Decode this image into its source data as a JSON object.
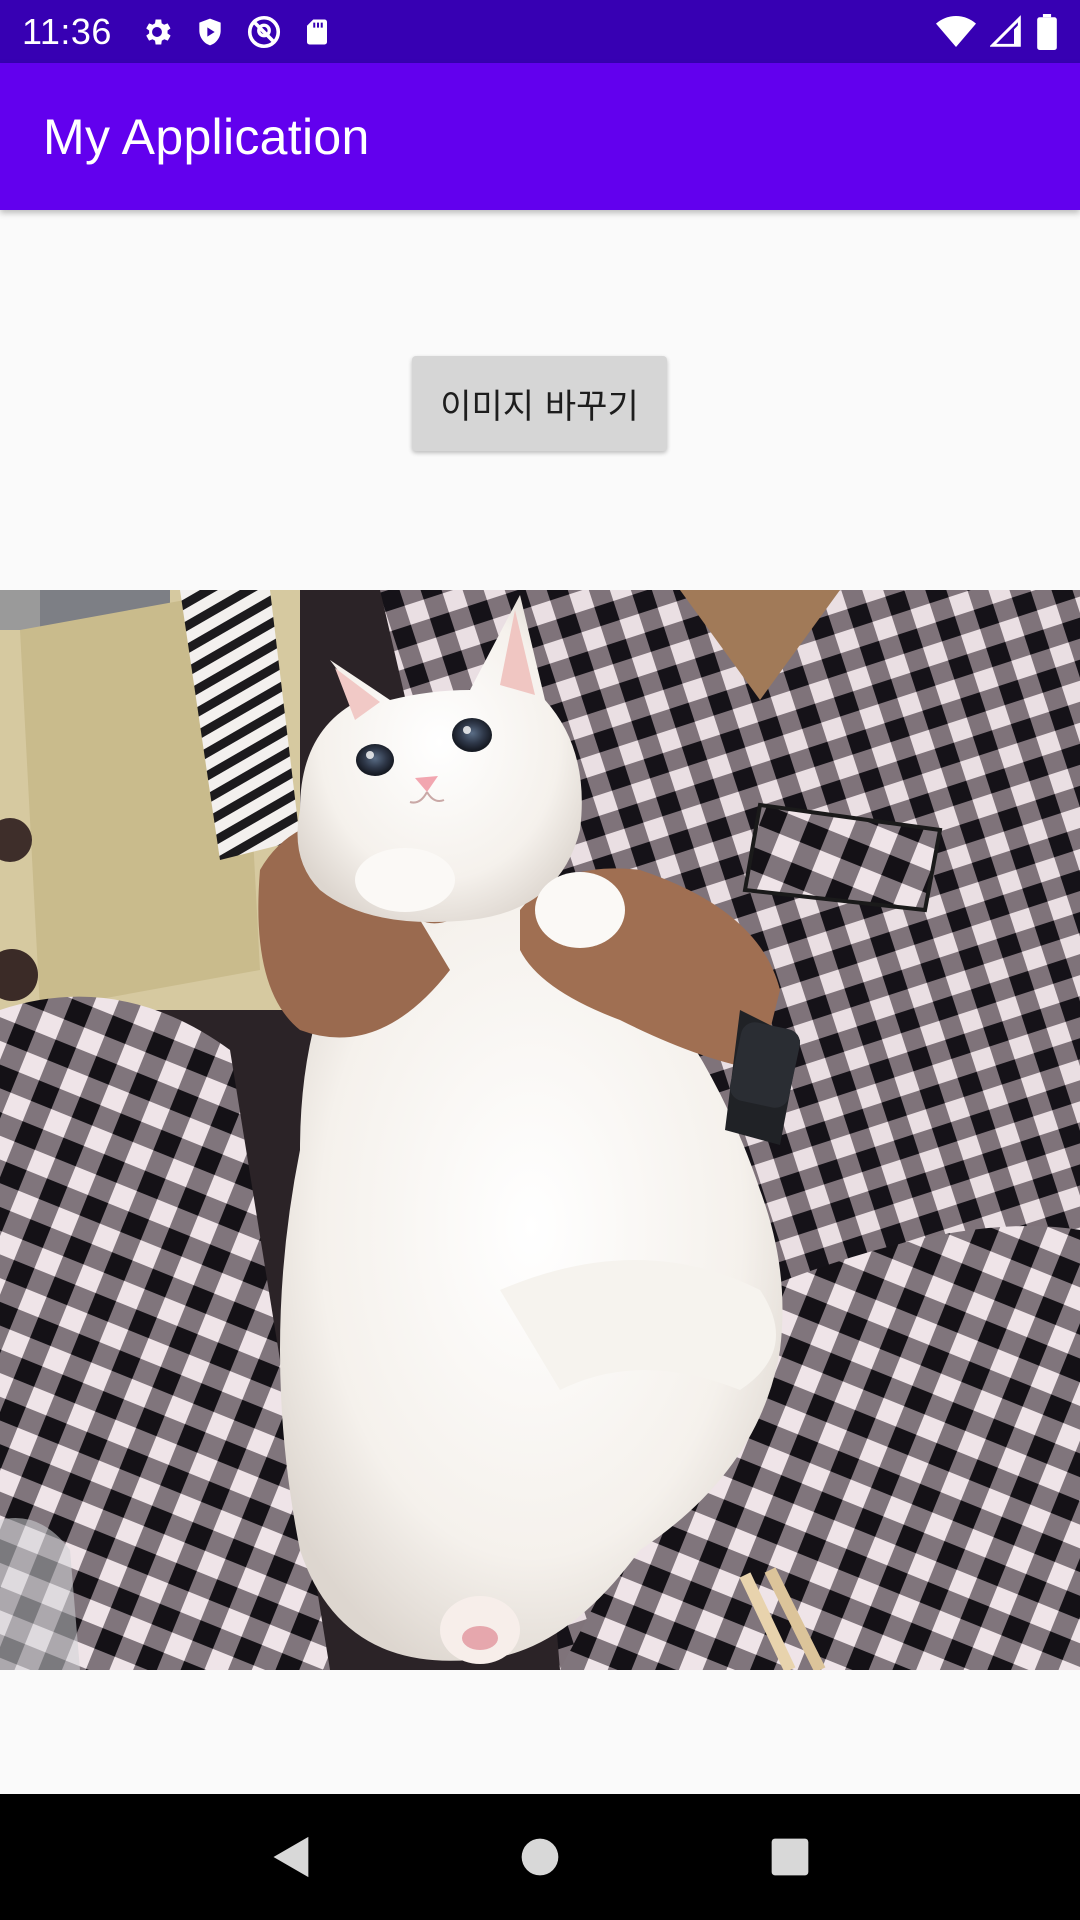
{
  "status_bar": {
    "time": "11:36",
    "left_icons": [
      "settings-icon",
      "shield-icon",
      "no-location-icon",
      "sd-card-icon"
    ],
    "right_icons": [
      "wifi-icon",
      "cell-signal-icon",
      "battery-icon"
    ]
  },
  "app_bar": {
    "title": "My Application",
    "color": "#6200ee",
    "status_color": "#3700b3"
  },
  "main": {
    "button_label": "이미지 바꾸기",
    "image": {
      "alt": "cat-photo",
      "subject": "white cat held in lap on gingham pajamas"
    }
  },
  "nav_bar": {
    "buttons": [
      "back-icon",
      "home-icon",
      "recents-icon"
    ]
  }
}
